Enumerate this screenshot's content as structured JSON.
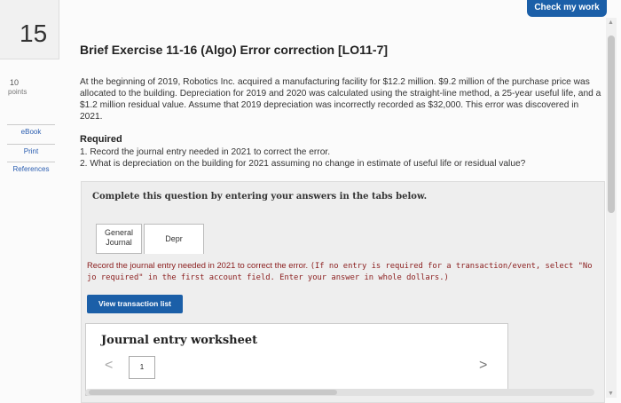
{
  "question": {
    "number": "15",
    "points_value": "10",
    "points_label": "points"
  },
  "sidebar": {
    "items": [
      {
        "label": "eBook"
      },
      {
        "label": "Print"
      },
      {
        "label": "References"
      }
    ]
  },
  "header": {
    "check_work_label": "Check my work"
  },
  "exercise": {
    "title": "Brief Exercise 11-16 (Algo) Error correction [LO11-7]",
    "paragraph": "At the beginning of 2019, Robotics Inc. acquired a manufacturing facility for $12.2 million. $9.2 million of the purchase price was allocated to the building. Depreciation for 2019 and 2020 was calculated using the straight-line method, a 25-year useful life, and a $1.2 million residual value. Assume that 2019 depreciation was incorrectly recorded as $32,000. This error was discovered in 2021.",
    "required_heading": "Required",
    "requirements": [
      "1. Record the journal entry needed in 2021 to correct the error.",
      "2. What is depreciation on the building for 2021 assuming no change in estimate of useful life or residual value?"
    ]
  },
  "panel": {
    "heading": "Complete this question by entering your answers in the tabs below.",
    "tabs": [
      {
        "label": "General Journal"
      },
      {
        "label": "Depr"
      }
    ],
    "instruction_main": "Record the journal entry needed in 2021 to correct the error. ",
    "instruction_note": "(If no entry is required for a transaction/event, select \"No jo required\" in the first account field. Enter your answer in whole dollars.)",
    "view_button_label": "View transaction list"
  },
  "journal": {
    "title": "Journal entry worksheet",
    "page_number": "1",
    "prev_symbol": "<",
    "next_symbol": ">"
  }
}
